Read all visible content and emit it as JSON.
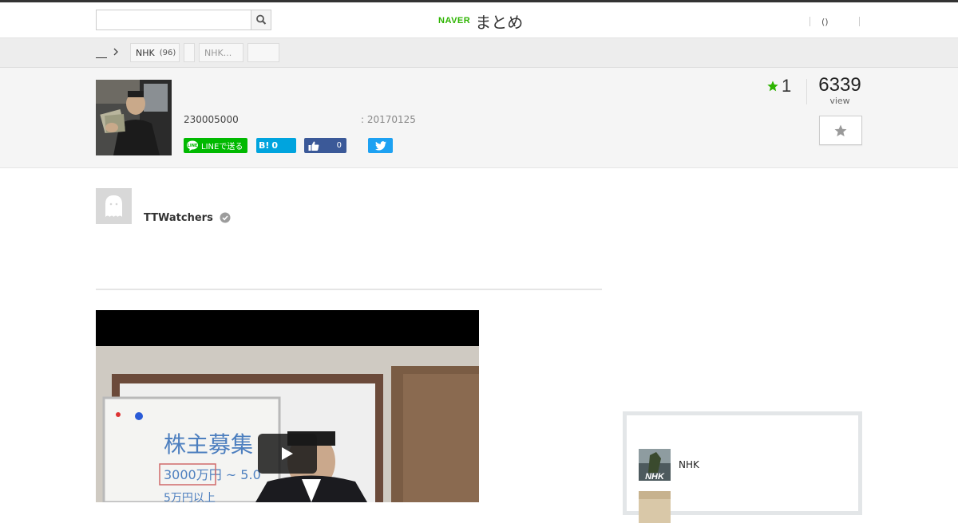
{
  "header": {
    "logo_naver": "NAVER",
    "logo_matome": "まとめ",
    "search_placeholder": "",
    "login_label": "()"
  },
  "breadcrumb": {
    "home_label": "",
    "tags": [
      {
        "label": "NHK",
        "count": "(96)"
      },
      {
        "label": "",
        "count": ""
      },
      {
        "label": "NHK...",
        "count": ""
      },
      {
        "label": "",
        "count": ""
      }
    ]
  },
  "article": {
    "view_count_value": "230005000",
    "date": ": 20170125",
    "share": {
      "line_label": "LINEで送る",
      "hatena_label": "B!",
      "hatena_count": "0",
      "fb_count": "0"
    },
    "favorites": "1",
    "views": "6339",
    "views_label": "view"
  },
  "author": {
    "name": "TTWatchers"
  },
  "sidebar": {
    "items": [
      {
        "label": "NHK"
      },
      {
        "label": ""
      }
    ]
  },
  "colors": {
    "brand_green": "#2db400",
    "line_green": "#00b900",
    "hatena_blue": "#00a4de",
    "facebook_blue": "#3b5998",
    "twitter_blue": "#1da1f2",
    "star_green": "#2db400"
  }
}
